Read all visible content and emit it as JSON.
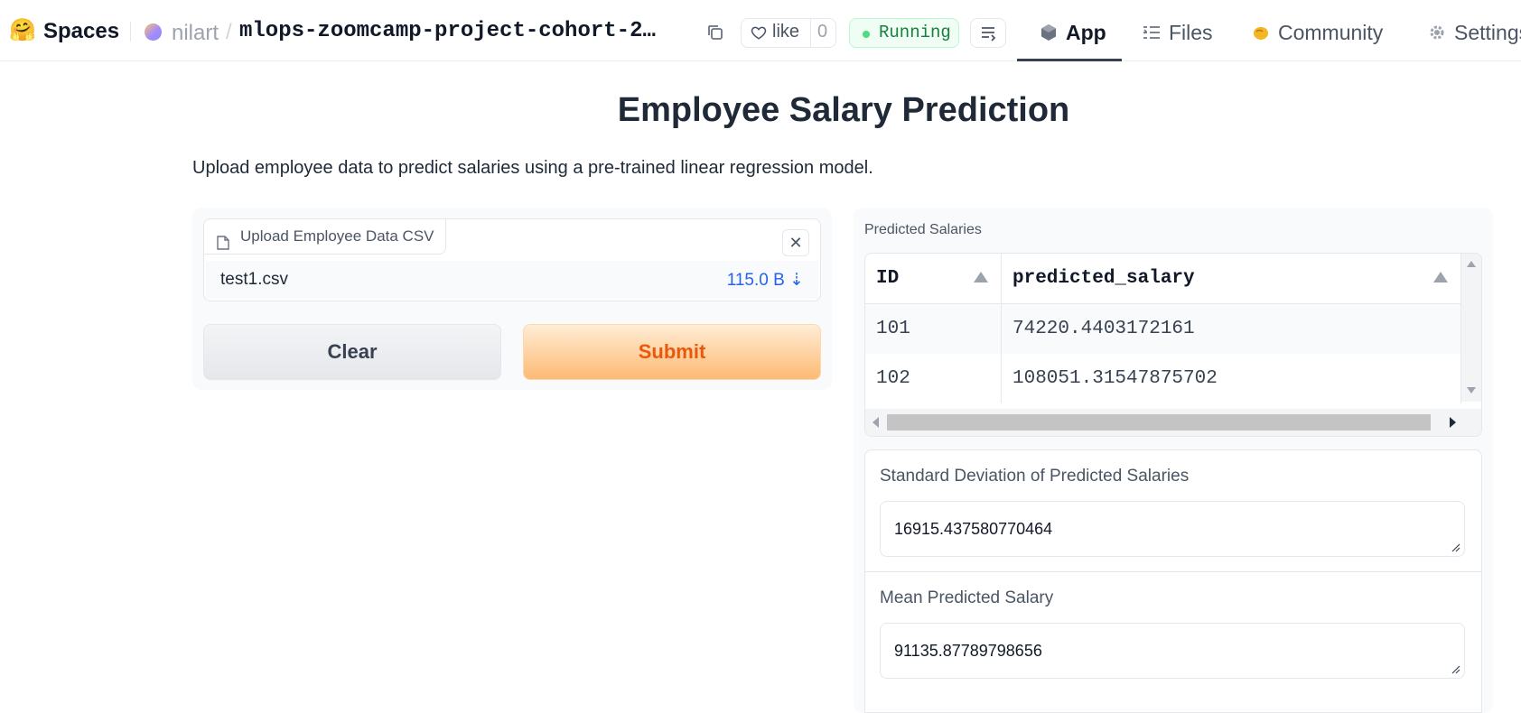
{
  "topbar": {
    "logo_emoji": "🤗",
    "brand": "Spaces",
    "owner": "nilart",
    "slash": "/",
    "repo": "mlops-zoomcamp-project-cohort-2…",
    "like_label": "like",
    "like_count": "0",
    "status": "Running",
    "status_color": "#15803d",
    "tabs": {
      "app": "App",
      "files": "Files",
      "community": "Community",
      "settings": "Settings"
    }
  },
  "page": {
    "title": "Employee Salary Prediction",
    "description": "Upload employee data to predict salaries using a pre-trained linear regression model."
  },
  "upload": {
    "label": "Upload Employee Data CSV",
    "file_name": "test1.csv",
    "file_size": "115.0 B ⇣",
    "clear_button": "Clear",
    "submit_button": "Submit",
    "accent": "#ea580c"
  },
  "results": {
    "label": "Predicted Salaries",
    "columns": [
      "ID",
      "predicted_salary"
    ],
    "rows": [
      [
        "101",
        "74220.4403172161"
      ],
      [
        "102",
        "108051.31547875702"
      ]
    ],
    "std_label": "Standard Deviation of Predicted Salaries",
    "std_value": "16915.437580770464",
    "mean_label": "Mean Predicted Salary",
    "mean_value": "91135.87789798656"
  }
}
